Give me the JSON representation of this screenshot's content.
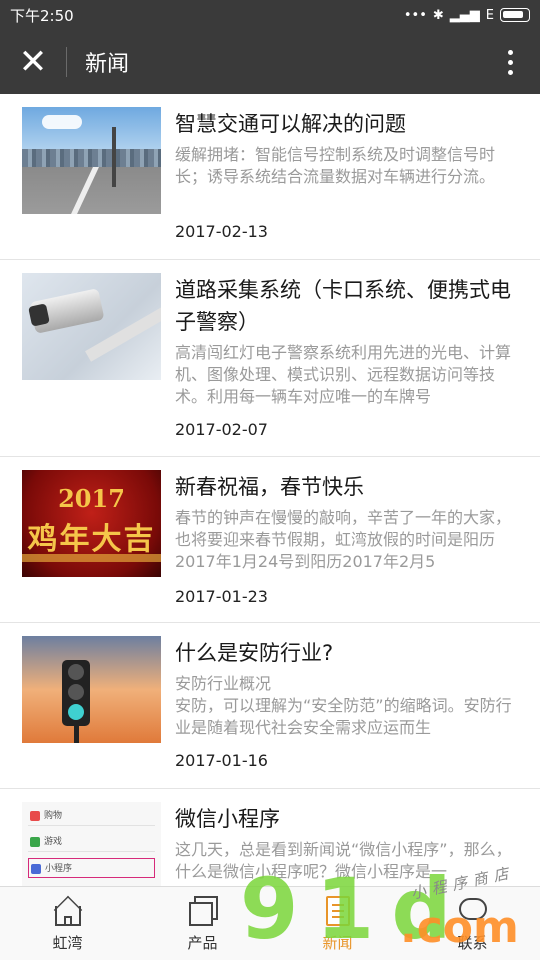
{
  "status_bar": {
    "time": "下午2:50",
    "network": "E"
  },
  "nav": {
    "title": "新闻"
  },
  "news": [
    {
      "title": "智慧交通可以解决的问题",
      "summary": "缓解拥堵：智能信号控制系统及时调整信号时长；诱导系统结合流量数据对车辆进行分流。",
      "date": "2017-02-13",
      "thumb": "highway-bridge-image"
    },
    {
      "title": "道路采集系统（卡口系统、便携式电子警察）",
      "summary": "高清闯红灯电子警察系统利用先进的光电、计算机、图像处理、模式识别、远程数据访问等技术。利用每一辆车对应唯一的车牌号",
      "date": "2017-02-07",
      "thumb": "surveillance-camera-image"
    },
    {
      "title": "新春祝福，春节快乐",
      "summary": "春节的钟声在慢慢的敲响，辛苦了一年的大家，也将要迎来春节假期，虹湾放假的时间是阳历2017年1月24号到阳历2017年2月5",
      "date": "2017-01-23",
      "thumb": "spring-festival-image",
      "thumb_text_1": "2017",
      "thumb_text_2": "鸡年大吉"
    },
    {
      "title": "什么是安防行业?",
      "summary": "安防行业概况\n安防，可以理解为“安全防范”的缩略词。安防行业是随着现代社会安全需求应运而生",
      "date": "2017-01-16",
      "thumb": "traffic-light-image"
    },
    {
      "title": "微信小程序",
      "summary": "这几天，总是看到新闻说“微信小程序”，那么，什么是微信小程序呢？微信小程序是一",
      "date": "",
      "thumb": "wechat-menu-image",
      "thumb_rows": [
        "购物",
        "游戏",
        "小程序"
      ]
    }
  ],
  "tabs": [
    {
      "label": "虹湾",
      "icon": "home-icon",
      "active": false
    },
    {
      "label": "产品",
      "icon": "product-icon",
      "active": false
    },
    {
      "label": "新闻",
      "icon": "news-icon",
      "active": true
    },
    {
      "label": "联系",
      "icon": "contact-icon",
      "active": false
    }
  ],
  "watermark": {
    "main": "9 1 d",
    "suffix": ".com",
    "small": "小程序商店"
  },
  "colors": {
    "header_bg": "#3a3a3a",
    "accent": "#e8952a"
  }
}
